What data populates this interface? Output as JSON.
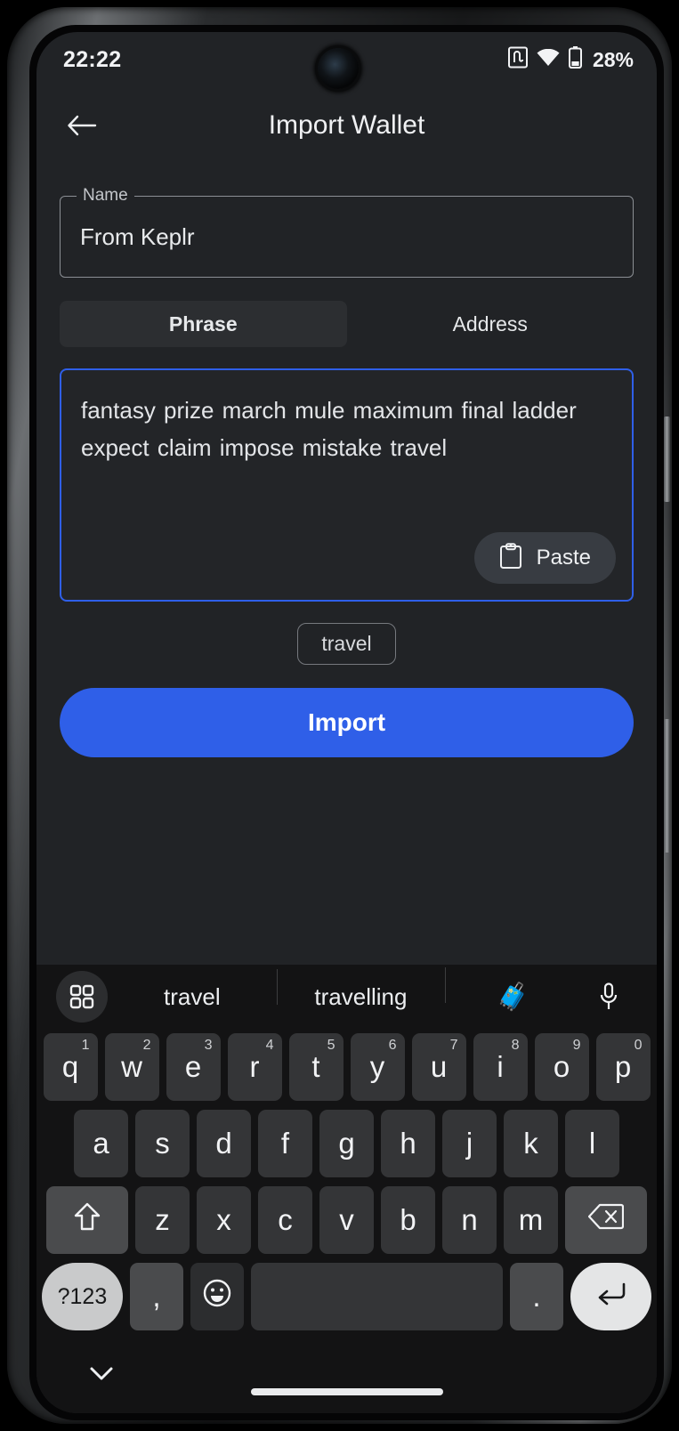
{
  "status_bar": {
    "time": "22:22",
    "battery_percent": "28%",
    "icons": [
      "nfc-icon",
      "wifi-icon",
      "battery-icon"
    ]
  },
  "header": {
    "title": "Import Wallet",
    "back_icon": "back-arrow-icon"
  },
  "name_field": {
    "label": "Name",
    "value": "From Keplr",
    "placeholder": "Name"
  },
  "tabs": [
    {
      "label": "Phrase",
      "selected": true
    },
    {
      "label": "Address",
      "selected": false
    }
  ],
  "phrase": {
    "value": "fantasy prize march mule maximum final ladder expect claim impose mistake travel",
    "words": [
      "fantasy",
      "prize",
      "march",
      "mule",
      "maximum",
      "final",
      "ladder",
      "expect",
      "claim",
      "impose",
      "mistake",
      "travel"
    ],
    "paste_label": "Paste",
    "paste_icon": "clipboard-icon",
    "border_color": "#2f5fe8"
  },
  "word_chip": {
    "label": "travel"
  },
  "import_button": {
    "label": "Import",
    "color": "#2f5fe8"
  },
  "keyboard": {
    "suggestions": [
      "travel",
      "travelling"
    ],
    "emoji_suggestion": "🧳",
    "grid_icon": "apps-grid-icon",
    "mic_icon": "microphone-icon",
    "rows": {
      "row1": [
        {
          "key": "q",
          "sup": "1"
        },
        {
          "key": "w",
          "sup": "2"
        },
        {
          "key": "e",
          "sup": "3"
        },
        {
          "key": "r",
          "sup": "4"
        },
        {
          "key": "t",
          "sup": "5"
        },
        {
          "key": "y",
          "sup": "6"
        },
        {
          "key": "u",
          "sup": "7"
        },
        {
          "key": "i",
          "sup": "8"
        },
        {
          "key": "o",
          "sup": "9"
        },
        {
          "key": "p",
          "sup": "0"
        }
      ],
      "row2": [
        "a",
        "s",
        "d",
        "f",
        "g",
        "h",
        "j",
        "k",
        "l"
      ],
      "row3": [
        "z",
        "x",
        "c",
        "v",
        "b",
        "n",
        "m"
      ],
      "shift_icon": "shift-arrow-icon",
      "backspace_icon": "backspace-icon",
      "numeric_label": "?123",
      "comma": ",",
      "period": ".",
      "emoji_icon": "emoji-smiley-icon",
      "space_label": "",
      "enter_icon": "enter-return-icon"
    }
  },
  "nav_bar": {
    "hide_keyboard_icon": "chevron-down-icon",
    "home_indicator": "home-indicator-bar"
  }
}
